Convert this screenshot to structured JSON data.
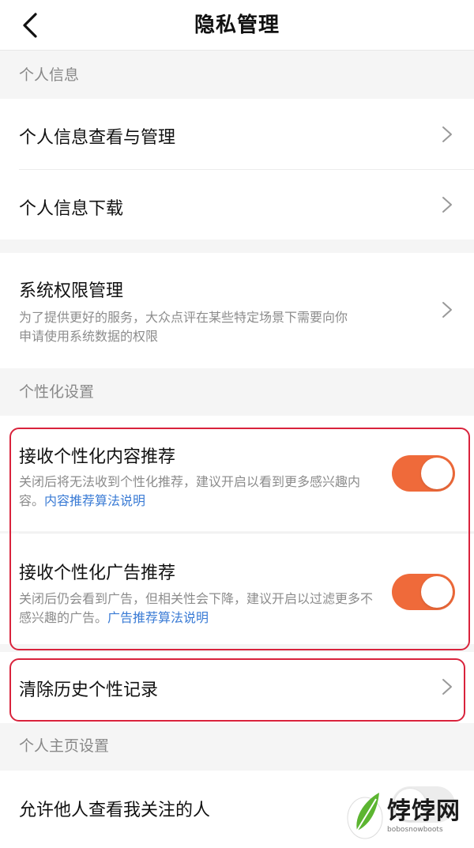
{
  "navbar": {
    "title": "隐私管理"
  },
  "sections": {
    "personal_info": "个人信息",
    "personalization": "个性化设置",
    "homepage": "个人主页设置"
  },
  "rows": {
    "view_manage": "个人信息查看与管理",
    "download": "个人信息下载",
    "permissions": {
      "title": "系统权限管理",
      "desc": "为了提供更好的服务，大众点评在某些特定场景下需要向你申请使用系统数据的权限"
    },
    "content_rec": {
      "title": "接收个性化内容推荐",
      "desc": "关闭后将无法收到个性化推荐，建议开启以看到更多感兴趣内容。",
      "link": "内容推荐算法说明",
      "enabled": true
    },
    "ad_rec": {
      "title": "接收个性化广告推荐",
      "desc": "关闭后仍会看到广告，但相关性会下降，建议开启以过滤更多不感兴趣的广告。",
      "link": "广告推荐算法说明",
      "enabled": true
    },
    "clear_history": "清除历史个性记录",
    "allow_following": {
      "title": "允许他人查看我关注的人",
      "enabled": false
    }
  },
  "watermark": {
    "text": "饽饽网",
    "sub": "bobosnowboots"
  },
  "colors": {
    "accent": "#ef6a3a",
    "link": "#3a7bd5",
    "highlight": "#d9233c"
  }
}
